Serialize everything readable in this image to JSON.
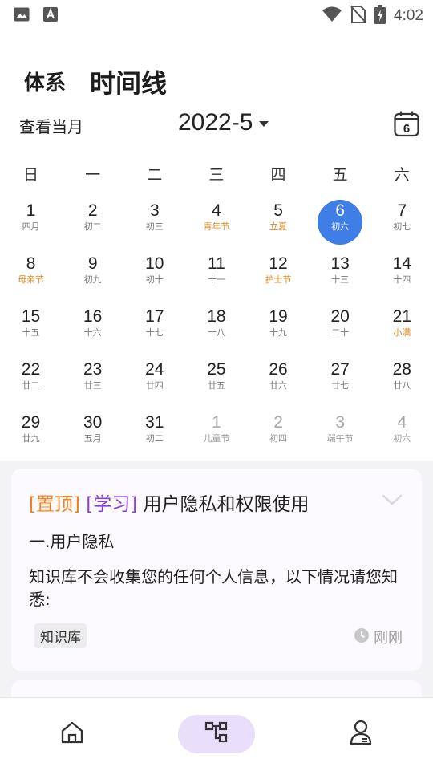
{
  "status_bar": {
    "time": "4:02"
  },
  "header": {
    "tab_system": "体系",
    "tab_timeline": "时间线"
  },
  "toolbar": {
    "view_current_month": "查看当月",
    "month": "2022-5",
    "today_date": "6"
  },
  "calendar": {
    "weekdays": [
      "日",
      "一",
      "二",
      "三",
      "四",
      "五",
      "六"
    ],
    "weeks": [
      [
        {
          "day": "1",
          "sub": "四月",
          "type": "normal"
        },
        {
          "day": "2",
          "sub": "初二",
          "type": "normal"
        },
        {
          "day": "3",
          "sub": "初三",
          "type": "normal"
        },
        {
          "day": "4",
          "sub": "青年节",
          "type": "festival"
        },
        {
          "day": "5",
          "sub": "立夏",
          "type": "festival"
        },
        {
          "day": "6",
          "sub": "初六",
          "type": "today"
        },
        {
          "day": "7",
          "sub": "初七",
          "type": "normal"
        }
      ],
      [
        {
          "day": "8",
          "sub": "母亲节",
          "type": "festival"
        },
        {
          "day": "9",
          "sub": "初九",
          "type": "normal"
        },
        {
          "day": "10",
          "sub": "初十",
          "type": "normal"
        },
        {
          "day": "11",
          "sub": "十一",
          "type": "normal"
        },
        {
          "day": "12",
          "sub": "护士节",
          "type": "festival"
        },
        {
          "day": "13",
          "sub": "十三",
          "type": "normal"
        },
        {
          "day": "14",
          "sub": "十四",
          "type": "normal"
        }
      ],
      [
        {
          "day": "15",
          "sub": "十五",
          "type": "normal"
        },
        {
          "day": "16",
          "sub": "十六",
          "type": "normal"
        },
        {
          "day": "17",
          "sub": "十七",
          "type": "normal"
        },
        {
          "day": "18",
          "sub": "十八",
          "type": "normal"
        },
        {
          "day": "19",
          "sub": "十九",
          "type": "normal"
        },
        {
          "day": "20",
          "sub": "二十",
          "type": "normal"
        },
        {
          "day": "21",
          "sub": "小满",
          "type": "festival"
        }
      ],
      [
        {
          "day": "22",
          "sub": "廿二",
          "type": "normal"
        },
        {
          "day": "23",
          "sub": "廿三",
          "type": "normal"
        },
        {
          "day": "24",
          "sub": "廿四",
          "type": "normal"
        },
        {
          "day": "25",
          "sub": "廿五",
          "type": "normal"
        },
        {
          "day": "26",
          "sub": "廿六",
          "type": "normal"
        },
        {
          "day": "27",
          "sub": "廿七",
          "type": "normal"
        },
        {
          "day": "28",
          "sub": "廿八",
          "type": "normal"
        }
      ],
      [
        {
          "day": "29",
          "sub": "廿九",
          "type": "normal"
        },
        {
          "day": "30",
          "sub": "五月",
          "type": "normal"
        },
        {
          "day": "31",
          "sub": "初二",
          "type": "normal"
        },
        {
          "day": "1",
          "sub": "儿童节",
          "type": "other"
        },
        {
          "day": "2",
          "sub": "初四",
          "type": "other"
        },
        {
          "day": "3",
          "sub": "端午节",
          "type": "other"
        },
        {
          "day": "4",
          "sub": "初六",
          "type": "other"
        }
      ]
    ]
  },
  "card": {
    "tag_pinned": "[置顶]",
    "tag_study": "[学习]",
    "title": "用户隐私和权限使用",
    "subtitle": "一.用户隐私",
    "body": "知识库不会收集您的任何个人信息，以下情况请您知悉:",
    "chip": "知识库",
    "time": "刚刚"
  },
  "bottom_nav": {
    "active": "timeline"
  },
  "colors": {
    "accent": "#3f7ee6",
    "festival": "#e08a1e",
    "tag_pinned": "#f08220",
    "tag_study": "#8a3fd6",
    "nav_active_bg": "#e9dffa"
  }
}
